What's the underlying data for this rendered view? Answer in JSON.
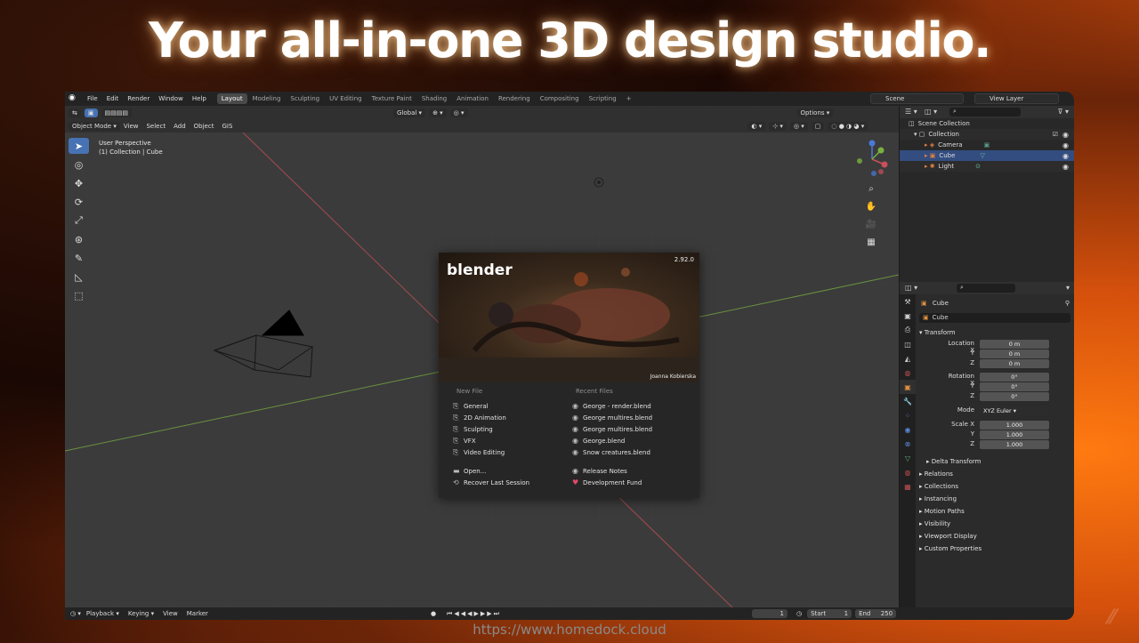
{
  "headline": "Your all-in-one 3D design studio.",
  "url_caption": "https://www.homedock.cloud",
  "menubar": {
    "menus": [
      "File",
      "Edit",
      "Render",
      "Window",
      "Help"
    ],
    "workspaces": [
      "Layout",
      "Modeling",
      "Sculpting",
      "UV Editing",
      "Texture Paint",
      "Shading",
      "Animation",
      "Rendering",
      "Compositing",
      "Scripting"
    ],
    "active_workspace": "Layout",
    "add_tab": "+",
    "scene": "Scene",
    "view_layer": "View Layer"
  },
  "viewport": {
    "mode": "Object Mode",
    "menus": [
      "View",
      "Select",
      "Add",
      "Object",
      "GIS"
    ],
    "orientation": "Global",
    "options": "Options",
    "info_line1": "User Perspective",
    "info_line2": "(1) Collection | Cube"
  },
  "splash": {
    "logo": "blender",
    "version": "2.92.0",
    "credit": "Joanna Kobierska",
    "new_file_heading": "New File",
    "new_file_items": [
      "General",
      "2D Animation",
      "Sculpting",
      "VFX",
      "Video Editing"
    ],
    "recent_heading": "Recent Files",
    "recent_items": [
      "George - render.blend",
      "George multires.blend",
      "George multires.blend",
      "George.blend",
      "Snow creatures.blend"
    ],
    "open": "Open...",
    "recover": "Recover Last Session",
    "release_notes": "Release Notes",
    "dev_fund": "Development Fund"
  },
  "timeline": {
    "menus": [
      "Playback",
      "Keying",
      "View",
      "Marker"
    ],
    "current_frame": "1",
    "start_label": "Start",
    "start_value": "1",
    "end_label": "End",
    "end_value": "250"
  },
  "outliner": {
    "scene_collection": "Scene Collection",
    "collection": "Collection",
    "items": [
      "Camera",
      "Cube",
      "Light"
    ]
  },
  "properties": {
    "object_name": "Cube",
    "datablock_name": "Cube",
    "transform_heading": "Transform",
    "location_label": "Location X",
    "location": [
      "0 m",
      "0 m",
      "0 m"
    ],
    "rotation_label": "Rotation X",
    "rotation": [
      "0°",
      "0°",
      "0°"
    ],
    "mode_label": "Mode",
    "mode_value": "XYZ Euler",
    "scale_label": "Scale X",
    "scale": [
      "1.000",
      "1.000",
      "1.000"
    ],
    "axis_y": "Y",
    "axis_z": "Z",
    "delta_transform": "Delta Transform",
    "sections": [
      "Relations",
      "Collections",
      "Instancing",
      "Motion Paths",
      "Visibility",
      "Viewport Display",
      "Custom Properties"
    ]
  },
  "colors": {
    "accent_blue": "#4772b3",
    "selection": "#334d80",
    "x_axis": "#c8505a",
    "y_axis": "#7ab040"
  }
}
